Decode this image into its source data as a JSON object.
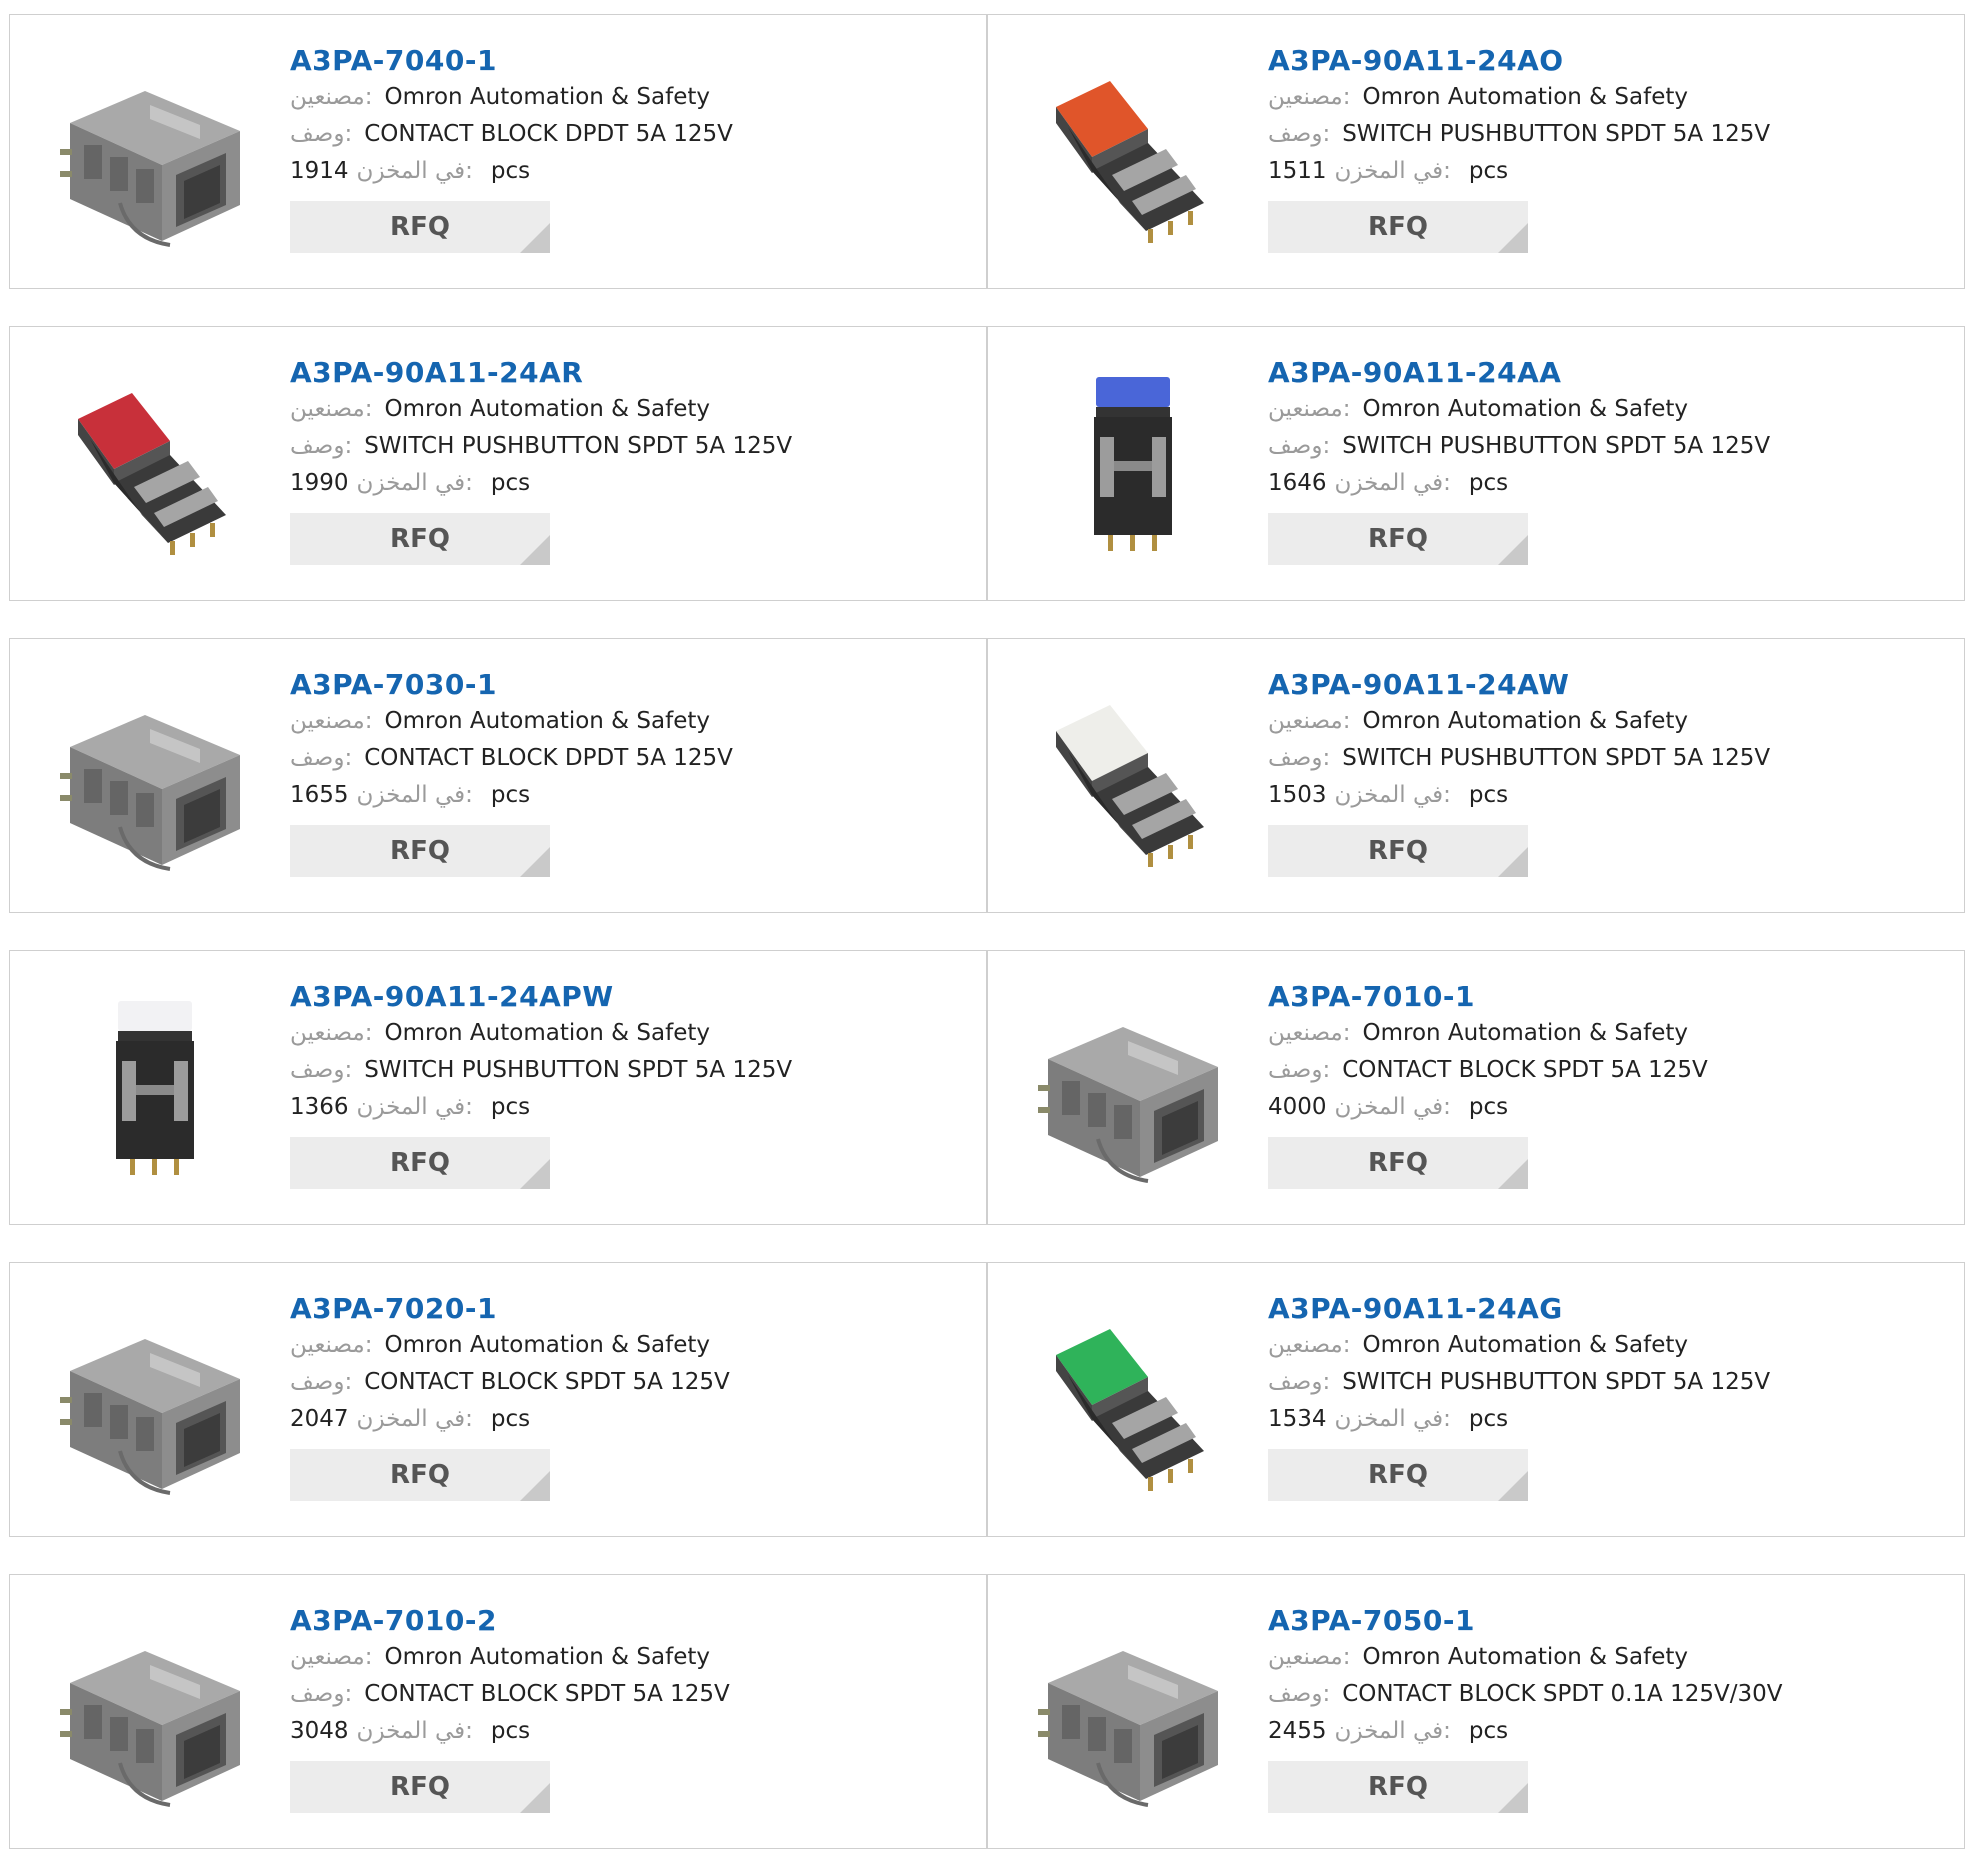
{
  "labels": {
    "manufacturer": "مصنعين:",
    "description": "وصف:",
    "stock": "في المخزن:",
    "unit": "pcs",
    "rfq": "RFQ"
  },
  "products": [
    {
      "part": "A3PA-7040-1",
      "manufacturer": "Omron Automation & Safety",
      "description": "CONTACT BLOCK DPDT 5A 125V",
      "stock": "1914",
      "image": "contact-block",
      "cap_color": ""
    },
    {
      "part": "A3PA-90A11-24AO",
      "manufacturer": "Omron Automation & Safety",
      "description": "SWITCH PUSHBUTTON SPDT 5A 125V",
      "stock": "1511",
      "image": "pushbutton-tilted",
      "cap_color": "#e0552a"
    },
    {
      "part": "A3PA-90A11-24AR",
      "manufacturer": "Omron Automation & Safety",
      "description": "SWITCH PUSHBUTTON SPDT 5A 125V",
      "stock": "1990",
      "image": "pushbutton-tilted",
      "cap_color": "#c8303a"
    },
    {
      "part": "A3PA-90A11-24AA",
      "manufacturer": "Omron Automation & Safety",
      "description": "SWITCH PUSHBUTTON SPDT 5A 125V",
      "stock": "1646",
      "image": "pushbutton-upright",
      "cap_color": "#4a66d8"
    },
    {
      "part": "A3PA-7030-1",
      "manufacturer": "Omron Automation & Safety",
      "description": "CONTACT BLOCK DPDT 5A 125V",
      "stock": "1655",
      "image": "contact-block",
      "cap_color": ""
    },
    {
      "part": "A3PA-90A11-24AW",
      "manufacturer": "Omron Automation & Safety",
      "description": "SWITCH PUSHBUTTON SPDT 5A 125V",
      "stock": "1503",
      "image": "pushbutton-tilted",
      "cap_color": "#eeeeea"
    },
    {
      "part": "A3PA-90A11-24APW",
      "manufacturer": "Omron Automation & Safety",
      "description": "SWITCH PUSHBUTTON SPDT 5A 125V",
      "stock": "1366",
      "image": "pushbutton-upright",
      "cap_color": "#f2f2f4"
    },
    {
      "part": "A3PA-7010-1",
      "manufacturer": "Omron Automation & Safety",
      "description": "CONTACT BLOCK SPDT 5A 125V",
      "stock": "4000",
      "image": "contact-block",
      "cap_color": ""
    },
    {
      "part": "A3PA-7020-1",
      "manufacturer": "Omron Automation & Safety",
      "description": "CONTACT BLOCK SPDT 5A 125V",
      "stock": "2047",
      "image": "contact-block",
      "cap_color": ""
    },
    {
      "part": "A3PA-90A11-24AG",
      "manufacturer": "Omron Automation & Safety",
      "description": "SWITCH PUSHBUTTON SPDT 5A 125V",
      "stock": "1534",
      "image": "pushbutton-tilted",
      "cap_color": "#2fb35a"
    },
    {
      "part": "A3PA-7010-2",
      "manufacturer": "Omron Automation & Safety",
      "description": "CONTACT BLOCK SPDT 5A 125V",
      "stock": "3048",
      "image": "contact-block",
      "cap_color": ""
    },
    {
      "part": "A3PA-7050-1",
      "manufacturer": "Omron Automation & Safety",
      "description": "CONTACT BLOCK SPDT 0.1A 125V/30V",
      "stock": "2455",
      "image": "contact-block",
      "cap_color": ""
    }
  ]
}
